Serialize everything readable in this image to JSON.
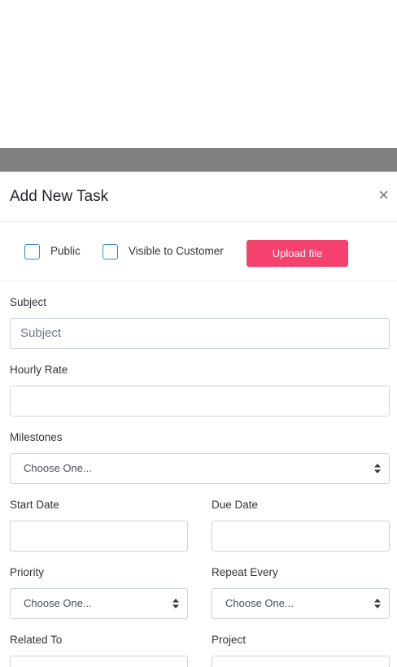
{
  "modal": {
    "title": "Add New Task",
    "close_symbol": "×",
    "options": {
      "public_label": "Public",
      "visible_label": "Visible to Customer",
      "upload_label": "Upload file"
    },
    "fields": {
      "subject_label": "Subject",
      "subject_placeholder": "Subject",
      "hourly_rate_label": "Hourly Rate",
      "milestones_label": "Milestones",
      "milestones_value": "Choose One...",
      "start_date_label": "Start Date",
      "due_date_label": "Due Date",
      "priority_label": "Priority",
      "priority_value": "Choose One...",
      "repeat_label": "Repeat Every",
      "repeat_value": "Choose One...",
      "related_label": "Related To",
      "project_label": "Project"
    }
  },
  "colors": {
    "accent": "#f4416e",
    "checkbox_border": "#2b8ac6",
    "overlay": "#808080"
  }
}
